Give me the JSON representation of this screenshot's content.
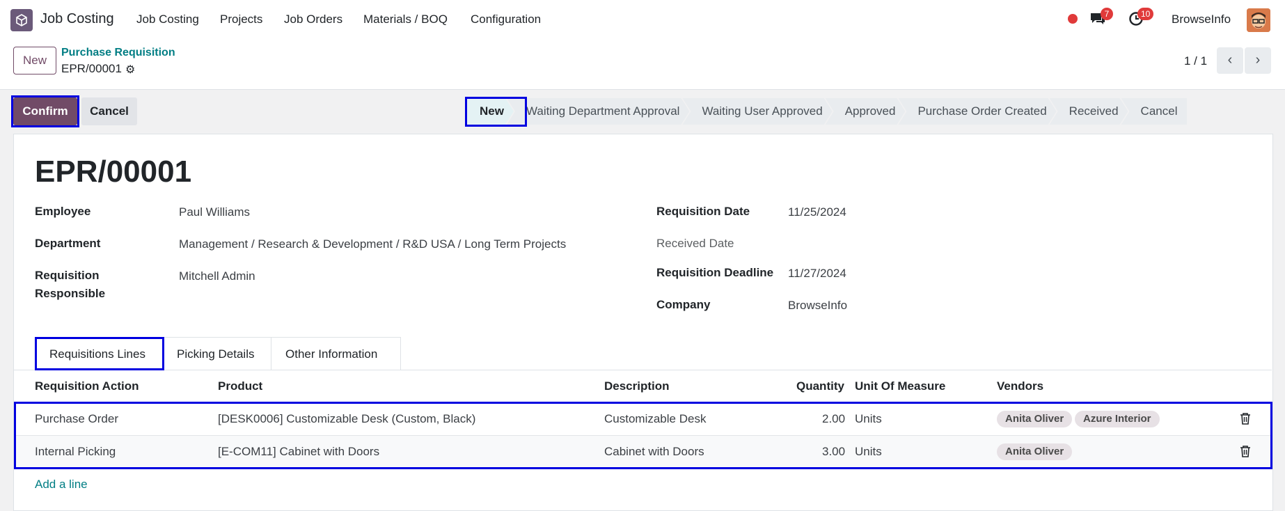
{
  "nav": {
    "app_name": "Job Costing",
    "menu": [
      "Job Costing",
      "Projects",
      "Job Orders",
      "Materials / BOQ",
      "Configuration"
    ],
    "messages_count": "7",
    "activities_count": "10",
    "company": "BrowseInfo"
  },
  "control": {
    "new_label": "New",
    "breadcrumb": "Purchase Requisition",
    "record": "EPR/00001",
    "pager": "1 / 1"
  },
  "actions": {
    "confirm": "Confirm",
    "cancel": "Cancel"
  },
  "stages": [
    "New",
    "Waiting Department Approval",
    "Waiting User Approved",
    "Approved",
    "Purchase Order Created",
    "Received",
    "Cancel"
  ],
  "active_stage": "New",
  "form": {
    "title": "EPR/00001",
    "employee_label": "Employee",
    "employee": "Paul Williams",
    "department_label": "Department",
    "department": "Management / Research & Development / R&D USA / Long Term Projects",
    "responsible_label_1": "Requisition",
    "responsible_label_2": "Responsible",
    "responsible": "Mitchell Admin",
    "req_date_label": "Requisition Date",
    "req_date": "11/25/2024",
    "received_date_label": "Received Date",
    "deadline_label": "Requisition Deadline",
    "deadline": "11/27/2024",
    "company_label": "Company",
    "company": "BrowseInfo"
  },
  "tabs": [
    "Requisitions Lines",
    "Picking Details",
    "Other Information"
  ],
  "table": {
    "headers": [
      "Requisition Action",
      "Product",
      "Description",
      "Quantity",
      "Unit Of Measure",
      "Vendors"
    ],
    "rows": [
      {
        "action": "Purchase Order",
        "product": "[DESK0006] Customizable Desk (Custom, Black)",
        "description": "Customizable Desk",
        "quantity": "2.00",
        "uom": "Units",
        "vendors": [
          "Anita Oliver",
          "Azure Interior"
        ]
      },
      {
        "action": "Internal Picking",
        "product": "[E-COM11] Cabinet with Doors",
        "description": "Cabinet with Doors",
        "quantity": "3.00",
        "uom": "Units",
        "vendors": [
          "Anita Oliver"
        ]
      }
    ],
    "add_line": "Add a line"
  },
  "colors": {
    "brand": "#714b67",
    "link": "#017e84",
    "highlight": "#0000e0"
  }
}
